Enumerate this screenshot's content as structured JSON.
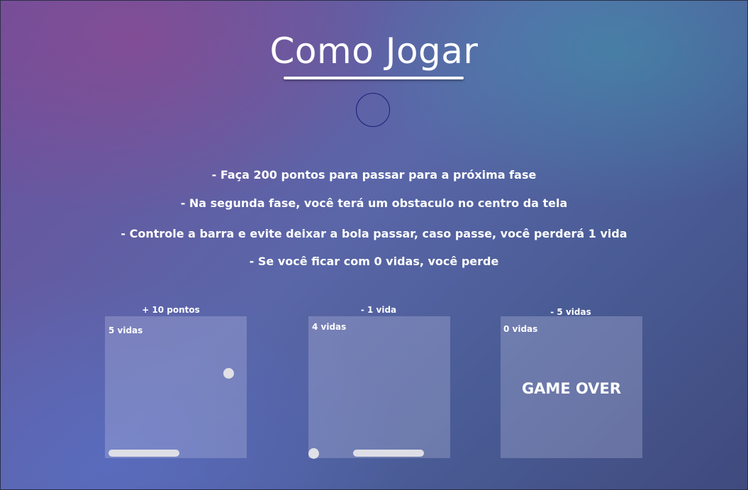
{
  "page": {
    "title": "Como Jogar"
  },
  "rules": [
    "- Faça 200 pontos para passar para a próxima fase",
    "- Na segunda fase, você terá um obstaculo no centro da tela",
    "- Controle a barra e evite deixar a bola passar, caso passe, você perderá 1 vida",
    "- Se você ficar com 0 vidas, você perde"
  ],
  "examples": [
    {
      "caption": "+ 10 pontos",
      "lives": "5 vidas"
    },
    {
      "caption": "- 1 vida",
      "lives": "4 vidas"
    },
    {
      "caption": "- 5 vidas",
      "lives": "0 vidas",
      "message": "GAME OVER"
    }
  ],
  "icons": {
    "ring": "circle-outline-icon",
    "ball": "ball-icon",
    "paddle": "paddle-bar"
  },
  "colors": {
    "ring_border": "#1a1f7a",
    "panel_fill": "#c8cdeb",
    "paddle": "#dedee6",
    "ball": "#e0e0e6",
    "text": "#ffffff"
  }
}
